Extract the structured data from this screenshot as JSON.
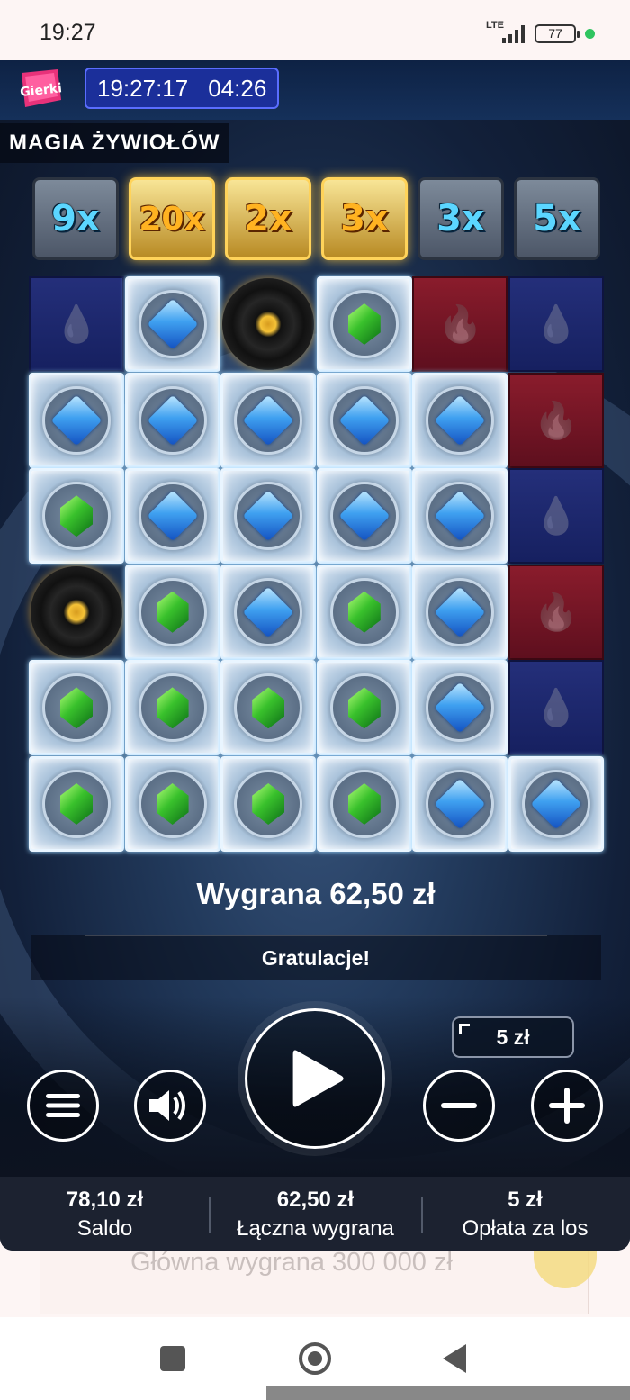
{
  "status_bar": {
    "time": "19:27",
    "network": "LTE",
    "battery": "77"
  },
  "game": {
    "logo": "Gierki",
    "clock": {
      "time": "19:27:17",
      "session": "04:26"
    },
    "title": "MAGIA ŻYWIOŁÓW",
    "multipliers": [
      {
        "label": "9x",
        "highlight": false
      },
      {
        "label": "20x",
        "highlight": true
      },
      {
        "label": "2x",
        "highlight": true
      },
      {
        "label": "3x",
        "highlight": true
      },
      {
        "label": "3x",
        "highlight": false
      },
      {
        "label": "5x",
        "highlight": false
      }
    ],
    "grid": [
      [
        "water",
        "blue",
        "portal",
        "green",
        "fire",
        "water"
      ],
      [
        "blue",
        "blue",
        "blue",
        "blue",
        "blue",
        "fire"
      ],
      [
        "green",
        "blue",
        "blue",
        "blue",
        "blue",
        "water"
      ],
      [
        "portal",
        "green",
        "blue",
        "green",
        "blue",
        "fire"
      ],
      [
        "green",
        "green",
        "green",
        "green",
        "blue",
        "water"
      ],
      [
        "green",
        "green",
        "green",
        "green",
        "blue",
        "blue"
      ]
    ],
    "win_text": "Wygrana 62,50 zł",
    "congrats": "Gratulacje!",
    "bet": "5 zł",
    "icons": {
      "menu": "hamburger-icon",
      "sound": "speaker-icon",
      "spin": "play-icon",
      "decrease": "minus-icon",
      "increase": "plus-icon"
    },
    "info": {
      "balance_value": "78,10 zł",
      "balance_label": "Saldo",
      "total_win_value": "62,50 zł",
      "total_win_label": "Łączna wygrana",
      "fee_value": "5 zł",
      "fee_label": "Opłata za los"
    }
  },
  "background_page": {
    "jackpot_text": "Główna wygrana 300 000 zł"
  },
  "colors": {
    "water": "#1d2770",
    "fire": "#7a1828",
    "gold": "#ffb321",
    "accent_blue": "#5bd6ff"
  }
}
